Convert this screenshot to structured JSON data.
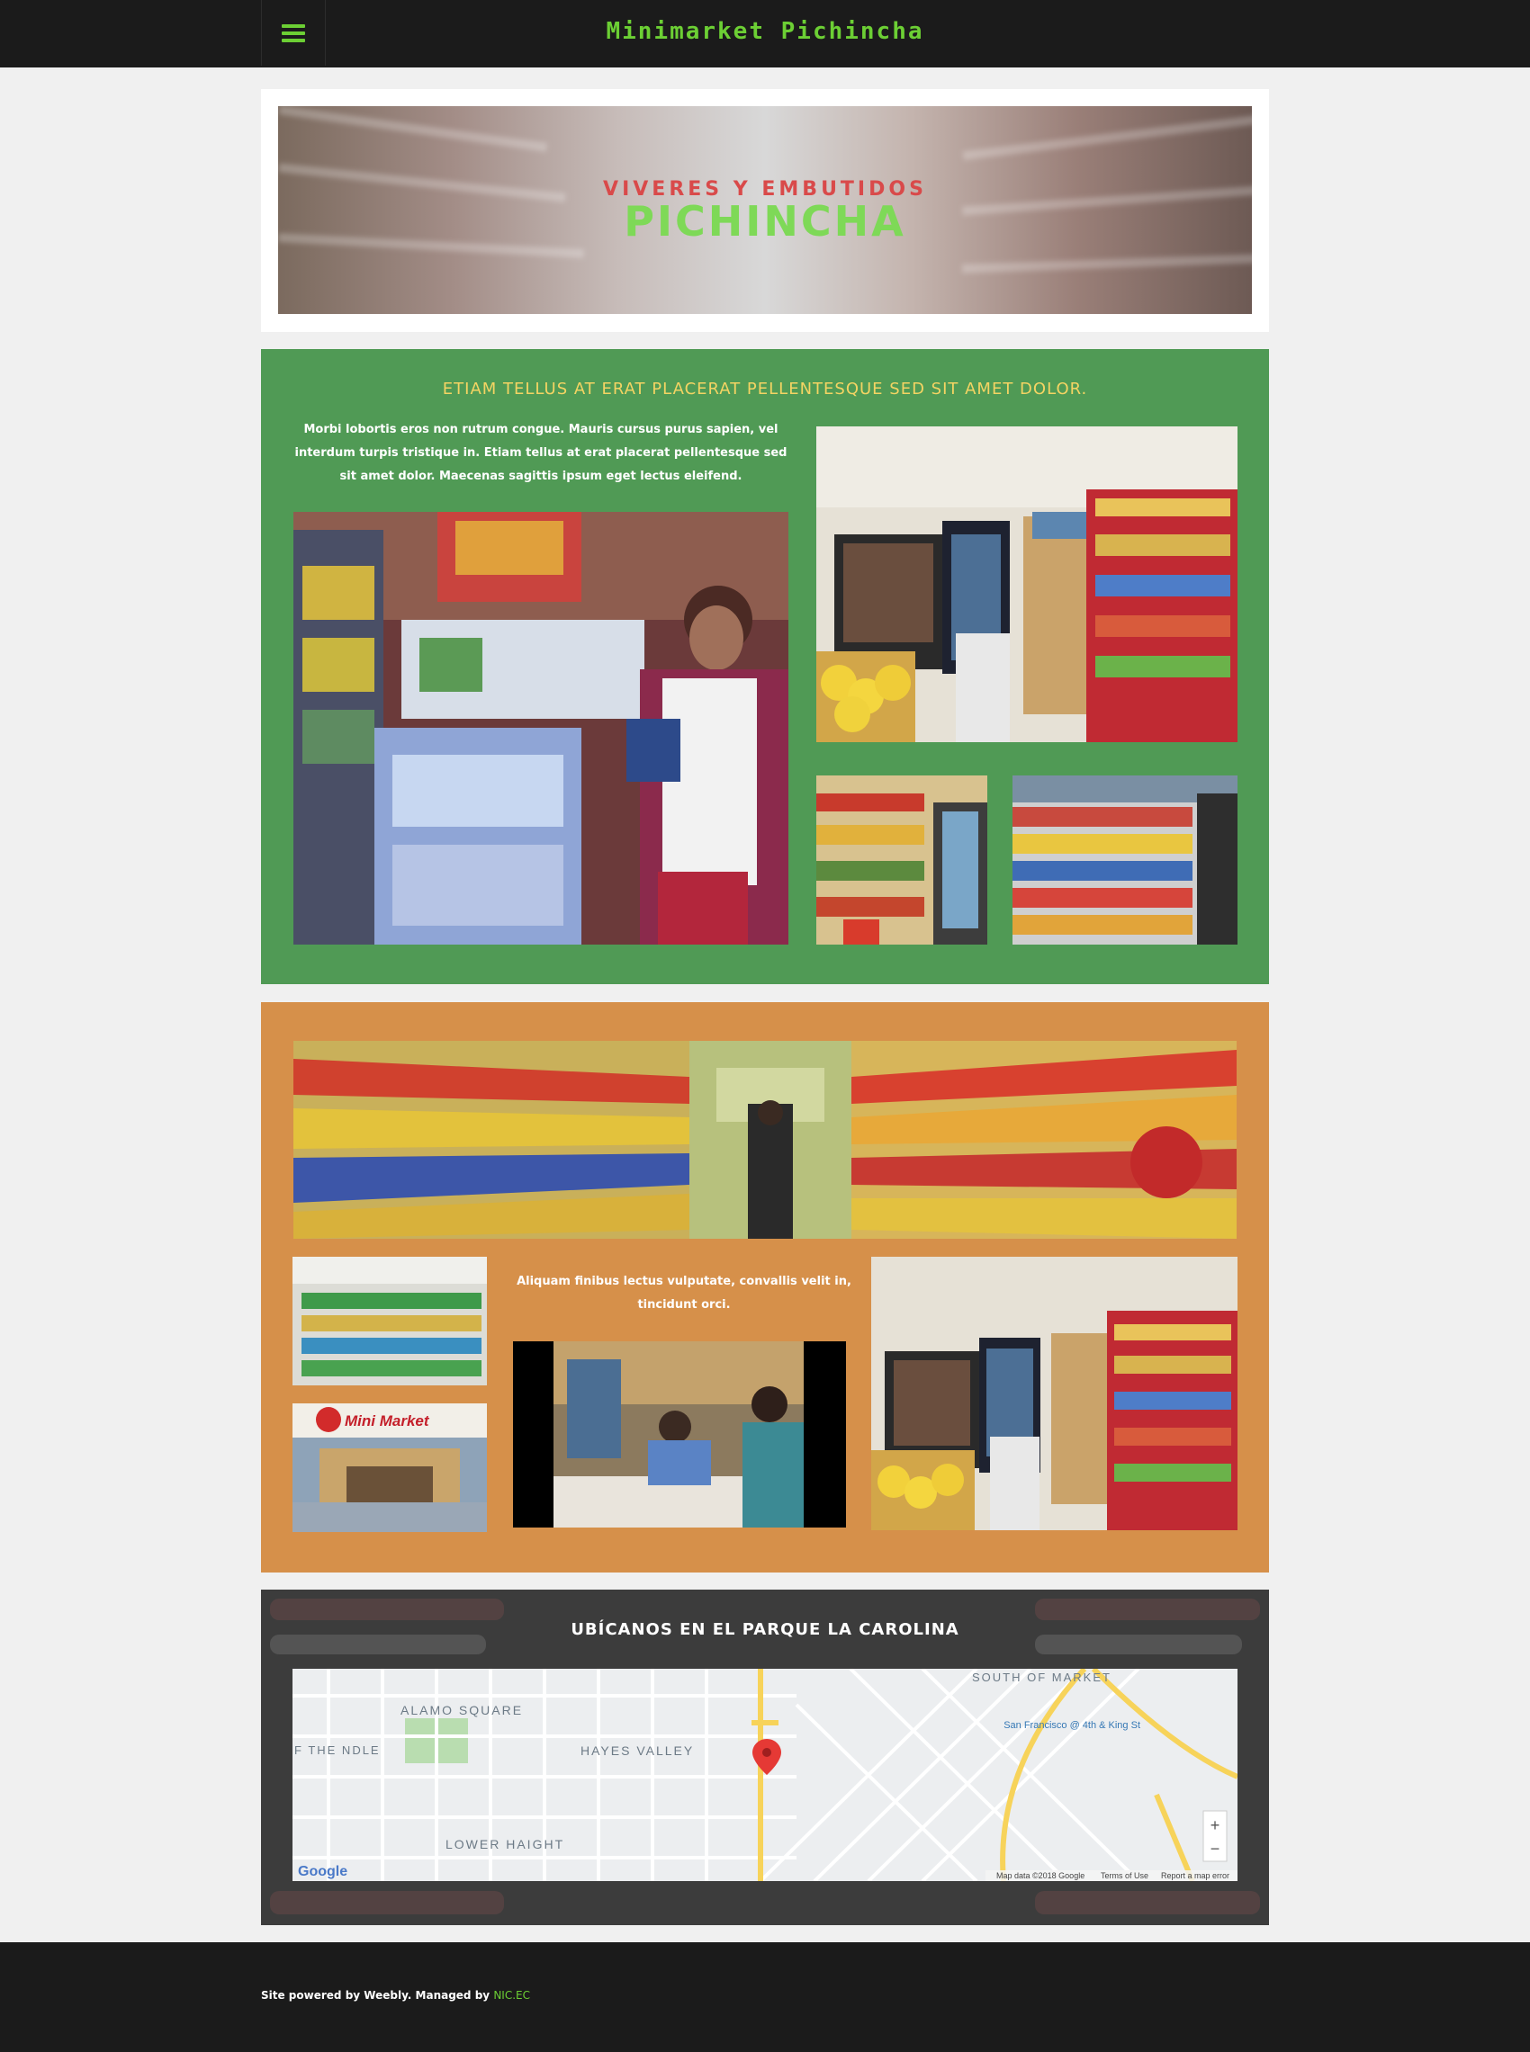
{
  "header": {
    "site_title": "Minimarket Pichincha",
    "menu_icon": "hamburger-icon",
    "accent_color": "#6ccf34"
  },
  "hero": {
    "subtitle": "VIVERES Y EMBUTIDOS",
    "title": "PICHINCHA"
  },
  "section_green": {
    "heading": "ETIAM TELLUS AT ERAT PLACERAT PELLENTESQUE SED SIT AMET DOLOR.",
    "body": "Morbi lobortis eros non rutrum congue. Mauris cursus purus sapien, vel interdum turpis tristique in. Etiam tellus at erat placerat pellentesque sed sit amet dolor. Maecenas sagittis ipsum eget lectus eleifend.",
    "background": "#509a55"
  },
  "section_orange": {
    "body": "Aliquam finibus lectus vulputate, convallis velit in, tincidunt orci.",
    "logo_sign": "Mini Market",
    "background": "#d6904a"
  },
  "section_map": {
    "heading": "UBÍCANOS EN EL PARQUE LA CAROLINA",
    "labels": {
      "alamo": "ALAMO SQUARE",
      "hayes": "HAYES VALLEY",
      "lower": "LOWER HAIGHT",
      "south": "SOUTH OF MARKET",
      "western": "F THE NDLE",
      "sf": "San Francisco @ 4th & King St",
      "google": "Google",
      "attribution": "Map data ©2018 Google",
      "terms": "Terms of Use",
      "report": "Report a map error",
      "zoom_in": "+",
      "zoom_out": "−"
    }
  },
  "footer": {
    "text": "Site powered by Weebly. Managed by",
    "link": "NIC.EC"
  }
}
